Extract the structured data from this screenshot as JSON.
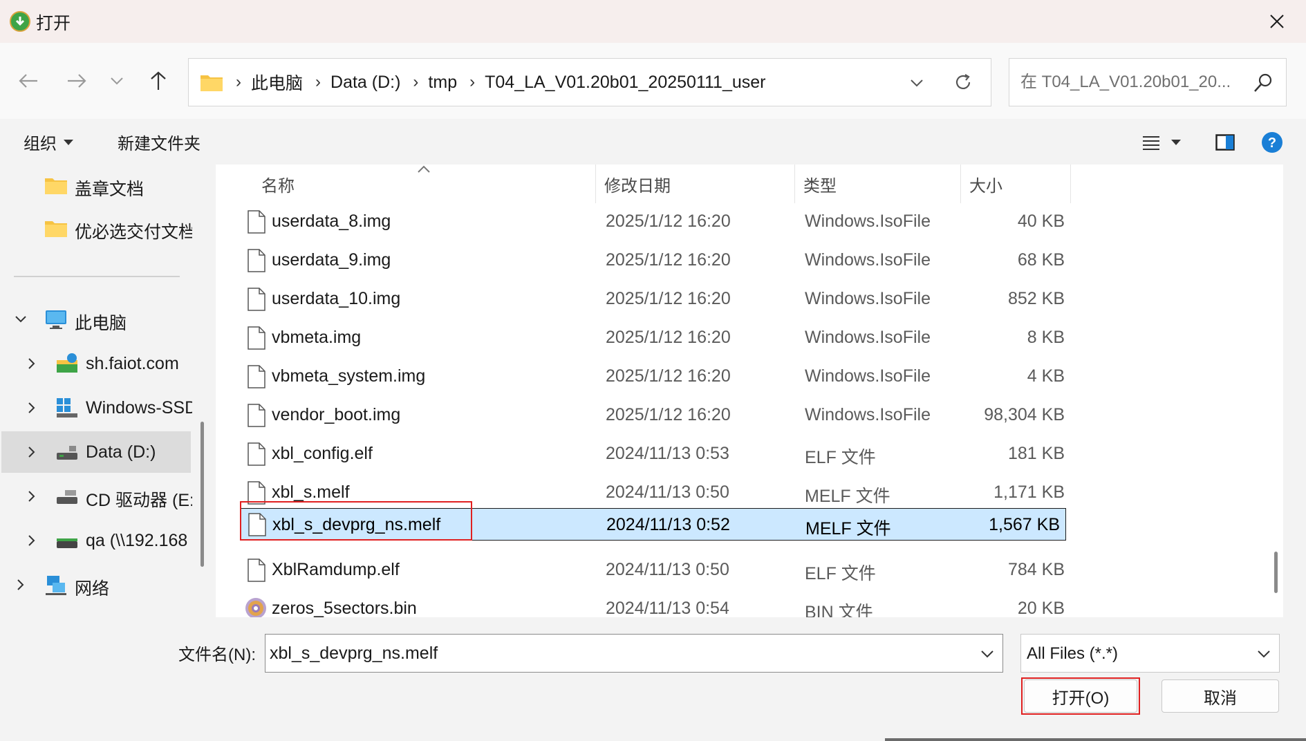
{
  "title": "打开",
  "address": {
    "crumbs": [
      "此电脑",
      "Data (D:)",
      "tmp",
      "T04_LA_V01.20b01_20250111_user"
    ]
  },
  "search": {
    "placeholder": "在 T04_LA_V01.20b01_20..."
  },
  "cmdbar": {
    "organize": "组织",
    "new_folder": "新建文件夹"
  },
  "navpane": {
    "items": [
      {
        "label": "盖章文档",
        "icon": "folder-icon"
      },
      {
        "label": "优必选交付文档",
        "icon": "folder-icon"
      },
      {
        "label": "此电脑",
        "icon": "computer-icon"
      },
      {
        "label": "sh.faiot.com",
        "icon": "network-drive-icon"
      },
      {
        "label": "Windows-SSD",
        "icon": "windows-drive-icon"
      },
      {
        "label": "Data (D:)",
        "icon": "drive-icon"
      },
      {
        "label": "CD 驱动器 (E:)",
        "icon": "cd-drive-icon"
      },
      {
        "label": "qa (\\\\192.168",
        "icon": "network-share-icon"
      },
      {
        "label": "网络",
        "icon": "network-icon"
      }
    ]
  },
  "columns": {
    "name": "名称",
    "date": "修改日期",
    "type": "类型",
    "size": "大小"
  },
  "files": [
    {
      "name": "userdata_8.img",
      "date": "2025/1/12 16:20",
      "type": "Windows.IsoFile",
      "size": "40 KB"
    },
    {
      "name": "userdata_9.img",
      "date": "2025/1/12 16:20",
      "type": "Windows.IsoFile",
      "size": "68 KB"
    },
    {
      "name": "userdata_10.img",
      "date": "2025/1/12 16:20",
      "type": "Windows.IsoFile",
      "size": "852 KB"
    },
    {
      "name": "vbmeta.img",
      "date": "2025/1/12 16:20",
      "type": "Windows.IsoFile",
      "size": "8 KB"
    },
    {
      "name": "vbmeta_system.img",
      "date": "2025/1/12 16:20",
      "type": "Windows.IsoFile",
      "size": "4 KB"
    },
    {
      "name": "vendor_boot.img",
      "date": "2025/1/12 16:20",
      "type": "Windows.IsoFile",
      "size": "98,304 KB"
    },
    {
      "name": "xbl_config.elf",
      "date": "2024/11/13 0:53",
      "type": "ELF 文件",
      "size": "181 KB"
    },
    {
      "name": "xbl_s.melf",
      "date": "2024/11/13 0:50",
      "type": "MELF 文件",
      "size": "1,171 KB"
    },
    {
      "name": "xbl_s_devprg_ns.melf",
      "date": "2024/11/13 0:52",
      "type": "MELF 文件",
      "size": "1,567 KB"
    },
    {
      "name": "XblRamdump.elf",
      "date": "2024/11/13 0:50",
      "type": "ELF 文件",
      "size": "784 KB"
    },
    {
      "name": "zeros_5sectors.bin",
      "date": "2024/11/13 0:54",
      "type": "BIN 文件",
      "size": "20 KB"
    }
  ],
  "selected_file": "xbl_s_devprg_ns.melf",
  "bottom": {
    "filename_label": "文件名(N):",
    "filename_value": "xbl_s_devprg_ns.melf",
    "filter_value": "All Files (*.*)",
    "open_label": "打开(O)",
    "cancel_label": "取消"
  },
  "colors": {
    "selection_bg": "#cce8ff",
    "highlight_red": "#e02020",
    "folder_yellow": "#f6c343",
    "help_blue": "#1a7fd6"
  }
}
